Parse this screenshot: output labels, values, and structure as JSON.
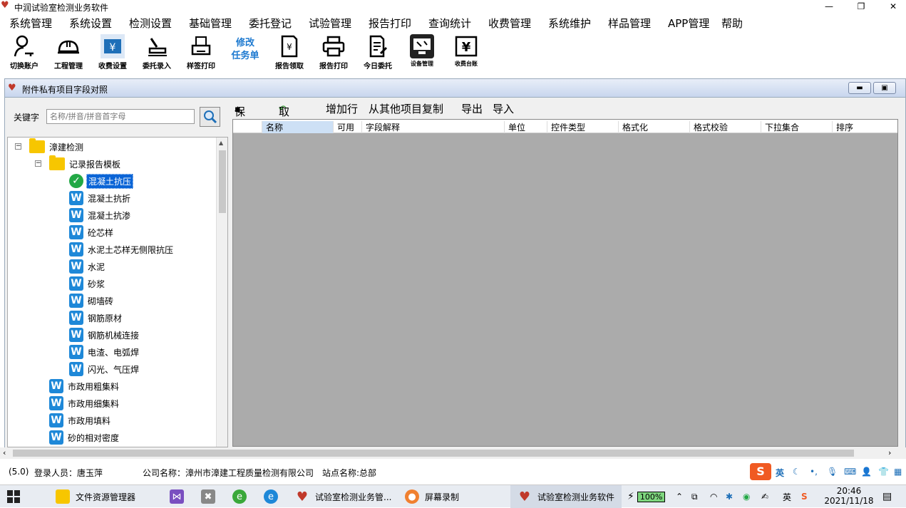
{
  "window": {
    "title": "中润试验室检测业务软件",
    "controls": [
      "—",
      "❐",
      "✕"
    ]
  },
  "menu": [
    "系统管理",
    "系统设置",
    "检测设置",
    "基础管理",
    "委托登记",
    "试验管理",
    "报告打印",
    "查询统计",
    "收费管理",
    "系统维护",
    "样品管理",
    "APP管理",
    "帮助"
  ],
  "toolbar": {
    "switch_account": "切换账户",
    "project_mgmt": "工程管理",
    "fee_setting": "收费设置",
    "entrust_entry": "委托录入",
    "label_print": "样签打印",
    "modify_line1": "修改",
    "modify_line2": "任务单",
    "report_collect": "报告领取",
    "report_print": "报告打印",
    "today_entrust": "今日委托",
    "device_mgmt": "设备管理",
    "fee_ledger": "收费台账"
  },
  "child": {
    "title": "附件私有项目字段对照"
  },
  "search": {
    "label": "关键字",
    "placeholder": "名称/拼音/拼音首字母"
  },
  "tree": {
    "root": "漳建检测",
    "folder": "记录报告模板",
    "items": [
      "混凝土抗压",
      "混凝土抗折",
      "混凝土抗渗",
      "砼芯样",
      "水泥土芯样无侧限抗压",
      "水泥",
      "砂浆",
      "砌墙砖",
      "钢筋原材",
      "钢筋机械连接",
      "电渣、电弧焊",
      "闪光、气压焊"
    ],
    "root_items": [
      "市政用粗集料",
      "市政用细集料",
      "市政用填料",
      "砂的相对密度"
    ]
  },
  "right_toolbar": {
    "save": "保存",
    "cancel": "取消",
    "add_row": "增加行",
    "copy_from": "从其他项目复制",
    "export": "导出",
    "import": "导入"
  },
  "grid": {
    "columns": [
      "名称",
      "可用",
      "字段解释",
      "单位",
      "控件类型",
      "格式化",
      "格式校验",
      "下拉集合",
      "排序"
    ]
  },
  "status": {
    "version": "(5.0)",
    "login_label": "登录人员：唐玉萍",
    "company": "公司名称：漳州市漳建工程质量检测有限公司",
    "site": "站点名称:总部"
  },
  "taskbar": {
    "explorer": "文件资源管理器",
    "app1": "试验室检测业务管...",
    "recorder": "屏幕录制",
    "app2": "试验室检测业务软件",
    "battery": "100%",
    "ime": "英",
    "time": "20:46",
    "date": "2021/11/18"
  },
  "colors": {
    "selection": "#0a64d6",
    "grid_bg": "#ababab",
    "w_icon": "#1e88d8",
    "folder": "#f7c600"
  }
}
